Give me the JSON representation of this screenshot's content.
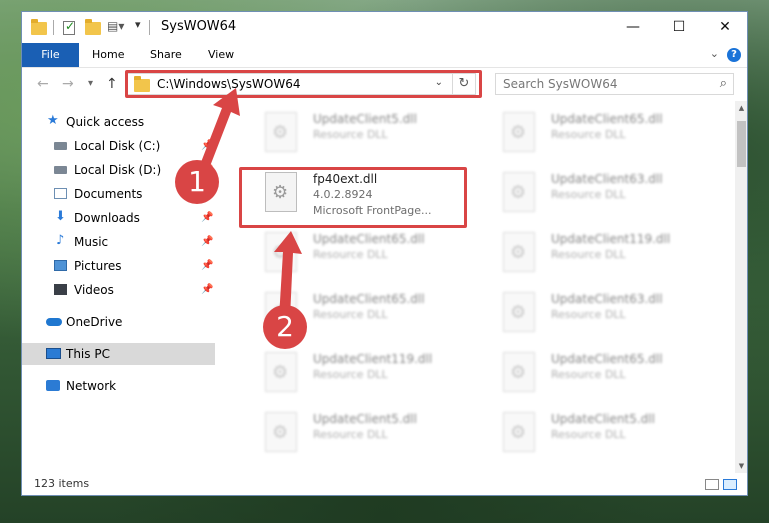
{
  "window": {
    "title": "SysWOW64",
    "controls": {
      "minimize": "—",
      "maximize": "☐",
      "close": "✕"
    }
  },
  "ribbon": {
    "tabs": [
      "File",
      "Home",
      "Share",
      "View"
    ],
    "help": "?"
  },
  "navbar": {
    "address": "C:\\Windows\\SysWOW64",
    "search_placeholder": "Search SysWOW64"
  },
  "sidebar": {
    "items": [
      {
        "label": "Quick access",
        "icon": "star-icon",
        "pinned": false
      },
      {
        "label": "Local Disk (C:)",
        "icon": "drive-icon",
        "pinned": true
      },
      {
        "label": "Local Disk (D:)",
        "icon": "drive-icon",
        "pinned": true
      },
      {
        "label": "Documents",
        "icon": "documents-icon",
        "pinned": true
      },
      {
        "label": "Downloads",
        "icon": "downloads-icon",
        "pinned": true
      },
      {
        "label": "Music",
        "icon": "music-icon",
        "pinned": true
      },
      {
        "label": "Pictures",
        "icon": "pictures-icon",
        "pinned": true
      },
      {
        "label": "Videos",
        "icon": "videos-icon",
        "pinned": true
      },
      {
        "label": "OneDrive",
        "icon": "onedrive-icon",
        "pinned": false
      },
      {
        "label": "This PC",
        "icon": "this-pc-icon",
        "pinned": false,
        "selected": true
      },
      {
        "label": "Network",
        "icon": "network-icon",
        "pinned": false
      }
    ]
  },
  "files": {
    "highlighted": {
      "name": "fp40ext.dll",
      "version": "4.0.2.8924",
      "description": "Microsoft FrontPage..."
    },
    "left_column": [
      {
        "name": "UpdateClient5.dll",
        "type": "Resource DLL"
      },
      {
        "name": "UpdateClient65.dll",
        "type": "Resource DLL"
      },
      {
        "name": "UpdateClient65.dll",
        "type": "Resource DLL"
      },
      {
        "name": "UpdateClient119.dll",
        "type": "Resource DLL"
      },
      {
        "name": "UpdateClient5.dll",
        "type": "Resource DLL"
      }
    ],
    "right_column": [
      {
        "name": "UpdateClient65.dll",
        "type": "Resource DLL"
      },
      {
        "name": "UpdateClient63.dll",
        "type": "Resource DLL"
      },
      {
        "name": "UpdateClient119.dll",
        "type": "Resource DLL"
      },
      {
        "name": "UpdateClient63.dll",
        "type": "Resource DLL"
      },
      {
        "name": "UpdateClient65.dll",
        "type": "Resource DLL"
      },
      {
        "name": "UpdateClient5.dll",
        "type": "Resource DLL"
      }
    ]
  },
  "status": {
    "item_count": "123 items"
  },
  "annotations": {
    "step1": "1",
    "step2": "2",
    "color": "#d94545"
  }
}
